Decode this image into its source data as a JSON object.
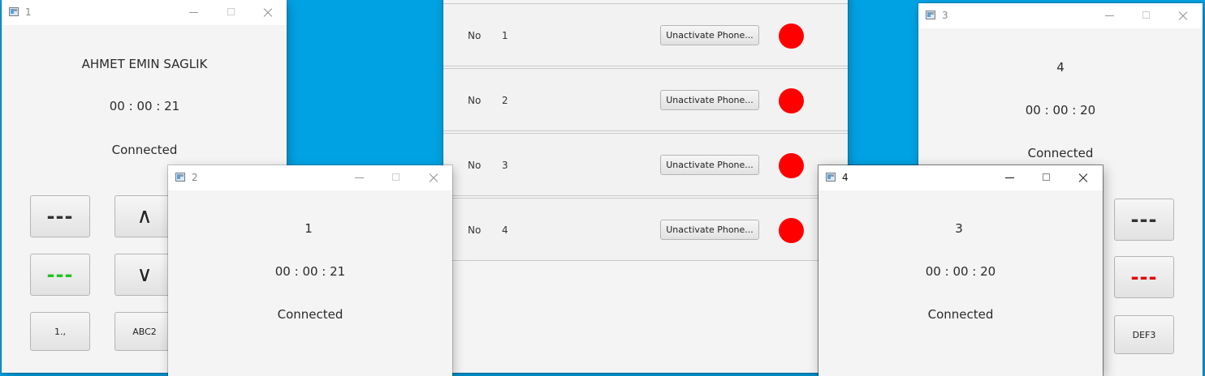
{
  "desktop_color": "#00a2e3",
  "window1": {
    "title": "1",
    "name": "AHMET EMIN SAGLIK",
    "timer": "00 : 00 : 21",
    "status": "Connected",
    "buttons": {
      "dash1": "---",
      "dash1_color": "#333333",
      "up": "∧",
      "dash2": "---",
      "dash2_color": "#22c322",
      "down": "∨",
      "key1": "1.,",
      "key2": "ABC2"
    }
  },
  "window2": {
    "title": "2",
    "name": "1",
    "timer": "00 : 00 : 21",
    "status": "Connected"
  },
  "list": {
    "rows": [
      {
        "label": "No",
        "number": "1",
        "button": "Unactivate Phone...",
        "dot_color": "#ff0000"
      },
      {
        "label": "No",
        "number": "2",
        "button": "Unactivate Phone...",
        "dot_color": "#ff0000"
      },
      {
        "label": "No",
        "number": "3",
        "button": "Unactivate Phone...",
        "dot_color": "#ff0000"
      },
      {
        "label": "No",
        "number": "4",
        "button": "Unactivate Phone...",
        "dot_color": "#ff0000"
      }
    ]
  },
  "window3": {
    "title": "3",
    "name": "4",
    "timer": "00 : 00 : 20",
    "status": "Connected",
    "buttons": {
      "dash1": "---",
      "dash1_color": "#333333",
      "dash2": "---",
      "dash2_color": "#e00000",
      "key3": "DEF3"
    }
  },
  "window4": {
    "title": "4",
    "name": "3",
    "timer": "00 : 00 : 20",
    "status": "Connected"
  },
  "icons": {
    "app": "app-window-icon",
    "minimize": "minimize-icon",
    "maximize": "maximize-icon",
    "close": "close-icon"
  }
}
